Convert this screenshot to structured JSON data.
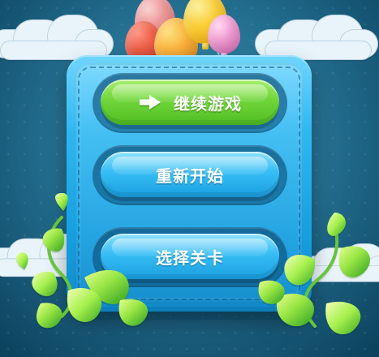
{
  "scene": {
    "background_color": "#176a92",
    "accent_blue": "#2db7f2",
    "accent_green": "#74d83d"
  },
  "menu": {
    "continue_label": "继续游戏",
    "restart_label": "重新开始",
    "select_level_label": "选择关卡"
  },
  "icons": {
    "continue_icon": "right-arrow-icon"
  }
}
